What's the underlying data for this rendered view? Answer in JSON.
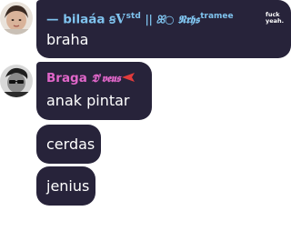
{
  "messages": [
    {
      "sender": {
        "name_prefix": "— bilaáa",
        "name_mark": "ꞩV",
        "name_sup": "std",
        "name_rest": "|| ꕤ○ 𝕹𝖗𝖍𝖘",
        "name_suffix": "tramee",
        "tag": "fuck yeah."
      },
      "text": "braha"
    },
    {
      "sender": {
        "name": "Braga",
        "name_fancy": "𝕯'𝖛𝖊𝖚𝖘"
      },
      "text": "anak pintar"
    },
    {
      "text": "cerdas"
    },
    {
      "text": "jenius"
    }
  ],
  "colors": {
    "bubble_bg": "#27233a",
    "name1": "#7fc3ee",
    "name2": "#e066c9",
    "text": "#ffffff"
  },
  "icons": [
    "avatar-girl-photo",
    "avatar-man-photo",
    "red-flag-icon"
  ]
}
